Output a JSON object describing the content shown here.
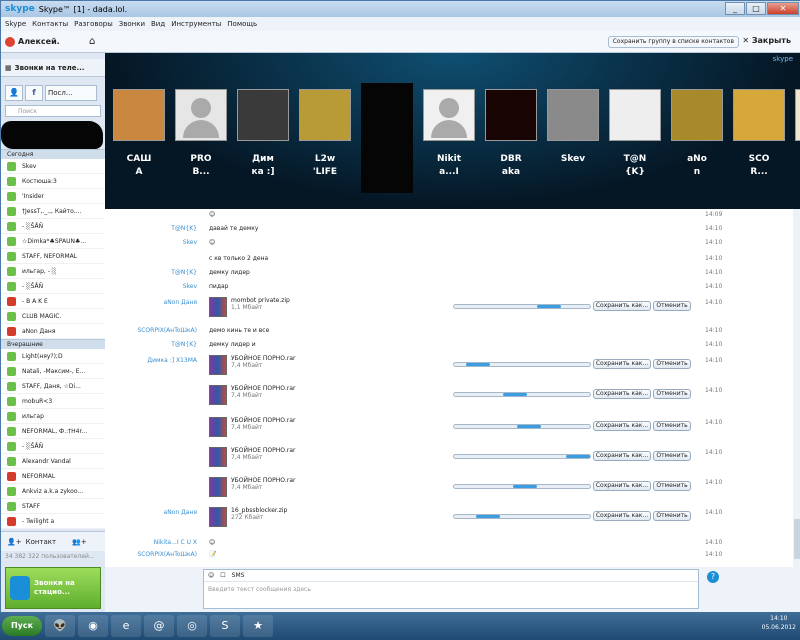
{
  "window": {
    "title": "Skype™ [1] - dada.lol.",
    "logo": "skype"
  },
  "menu": [
    "Skype",
    "Контакты",
    "Разговоры",
    "Звонки",
    "Вид",
    "Инструменты",
    "Помощь"
  ],
  "user": {
    "name": "Алексей."
  },
  "calls_button": "Звонки на теле...",
  "tabs": {
    "recent": "Посл..."
  },
  "search_placeholder": "Поиск",
  "groups": {
    "today": "Сегодня",
    "yesterday": "Вчерашние"
  },
  "contacts_today": [
    {
      "name": "Skev",
      "s": "g"
    },
    {
      "name": "Костюша:3",
      "s": "g"
    },
    {
      "name": "'Insider",
      "s": "g"
    },
    {
      "name": "†JessT,._.,, Кайто,...",
      "s": "g"
    },
    {
      "name": "- ░ŠÅÑ",
      "s": "g"
    },
    {
      "name": "☆Dimka*♣SPAUN♣...",
      "s": "g"
    },
    {
      "name": "STAFF, NEFORMAL",
      "s": "g"
    },
    {
      "name": "ильгар, - ░",
      "s": "g"
    },
    {
      "name": "- ░ŠÅÑ",
      "s": "g"
    },
    {
      "name": "- B A K E",
      "s": "r"
    },
    {
      "name": "CLUB MAGIC.",
      "s": "g"
    },
    {
      "name": "aNon Даня",
      "s": "r"
    }
  ],
  "contacts_yesterday": [
    {
      "name": "Light(няу?);D",
      "s": "g"
    },
    {
      "name": "Natali, -Максим-, E...",
      "s": "g"
    },
    {
      "name": "STAFF, Даня, ☆Di...",
      "s": "g"
    },
    {
      "name": "mobuR<3",
      "s": "g"
    },
    {
      "name": "ильгар",
      "s": "g"
    },
    {
      "name": "NEFORMAL, Ф.:†H4r...",
      "s": "g"
    },
    {
      "name": "- ░ŠÅÑ",
      "s": "g"
    },
    {
      "name": "Alexandr Vandal",
      "s": "g"
    },
    {
      "name": "NEFORMAL",
      "s": "r"
    },
    {
      "name": "Ankviz a.k.a zykoo...",
      "s": "g"
    },
    {
      "name": "STAFF",
      "s": "g"
    },
    {
      "name": "- Twilight a",
      "s": "r"
    }
  ],
  "bottom": {
    "contact_label": "Контакт",
    "user_count": "34 382 322 пользователей..."
  },
  "promo": "Звонки на стацио...",
  "header": {
    "save_group": "Сохранить группу в списке контактов",
    "close": "Закрыть",
    "skype_logo": "skype"
  },
  "participants": [
    {
      "l1": "САШ",
      "l2": "А",
      "img": "cat",
      "c": "#c9873f"
    },
    {
      "l1": "PRO",
      "l2": "B...",
      "img": "default",
      "c": "#e6e6e6"
    },
    {
      "l1": "Дим",
      "l2": "ка :]",
      "img": "joker",
      "c": "#3a3a3a"
    },
    {
      "l1": "L2w",
      "l2": "'LIFE",
      "img": "gold",
      "c": "#b89a36"
    },
    {
      "l1": "",
      "l2": "",
      "img": "hidden",
      "c": "#050505"
    },
    {
      "l1": "Nikit",
      "l2": "a...I",
      "img": "unknown",
      "c": "#f0f0f0"
    },
    {
      "l1": "DBR",
      "l2": "aka",
      "img": "eyes",
      "c": "#1a0505"
    },
    {
      "l1": "Skev",
      "l2": "",
      "img": "chair",
      "c": "#8a8a8a"
    },
    {
      "l1": "T@N",
      "l2": "{K}",
      "img": "knife",
      "c": "#eeeeee"
    },
    {
      "l1": "aNo",
      "l2": "n",
      "img": "goggles",
      "c": "#a88a2a"
    },
    {
      "l1": "SCO",
      "l2": "R...",
      "img": "logo",
      "c": "#d6a83a"
    },
    {
      "l1": "",
      "l2": "",
      "img": "dagger",
      "c": "#efe7cf"
    }
  ],
  "messages": [
    {
      "name": "",
      "text": "😊",
      "time": "14:09"
    },
    {
      "name": "T@N{K}",
      "text": "давай те демку",
      "time": "14:10"
    },
    {
      "name": "Skev",
      "text": "😊",
      "time": "14:10"
    },
    {
      "name": "",
      "text": "с кв только 2 дена",
      "time": "14:10"
    },
    {
      "name": "T@N{K}",
      "text": "демку лидер",
      "time": "14:10"
    },
    {
      "name": "Skev",
      "text": "пидар",
      "time": "14:10"
    },
    {
      "name": "SCORPIX(AнToШкА)",
      "text": "демо кинь те и все",
      "time": "14:10"
    },
    {
      "name": "T@N{K}",
      "text": "демку лидер и",
      "time": "14:10"
    },
    {
      "name": "Nikita...I C U X",
      "text": "😊",
      "time": "14:10"
    },
    {
      "name": "SCORPIX(AнToШкА)",
      "text": "📝",
      "time": "14:10"
    }
  ],
  "files": [
    {
      "sender": "aNon Даня",
      "name": "mombot private.zip",
      "size": "1,1 Мбайт",
      "progress": 0.7,
      "time": "14:10"
    },
    {
      "sender": "Димка :] X13MA",
      "name": "УБОЙНОЕ ПОРНО.rar",
      "size": "7,4 Мбайт",
      "progress": 0.18,
      "time": "14:10"
    },
    {
      "sender": "",
      "name": "УБОЙНОЕ ПОРНО.rar",
      "size": "7,4 Мбайт",
      "progress": 0.45,
      "time": "14:10"
    },
    {
      "sender": "",
      "name": "УБОЙНОЕ ПОРНО.rar",
      "size": "7,4 Мбайт",
      "progress": 0.55,
      "time": "14:10"
    },
    {
      "sender": "",
      "name": "УБОЙНОЕ ПОРНО.rar",
      "size": "7,4 Мбайт",
      "progress": 0.98,
      "time": "14:10"
    },
    {
      "sender": "",
      "name": "УБОЙНОЕ ПОРНО.rar",
      "size": "7,4 Мбайт",
      "progress": 0.52,
      "time": "14:10"
    },
    {
      "sender": "aNon Даня",
      "name": "16_pbssblocker.zip",
      "size": "272 Кбайт",
      "progress": 0.25,
      "time": "14:10"
    }
  ],
  "file_buttons": {
    "save": "Сохранить как...",
    "cancel": "Отменить"
  },
  "input": {
    "sms": "SMS",
    "placeholder": "Введите текст сообщения здесь",
    "help": "?"
  },
  "taskbar": {
    "start": "Пуск",
    "time": "14:10",
    "date": "05.06.2012"
  }
}
